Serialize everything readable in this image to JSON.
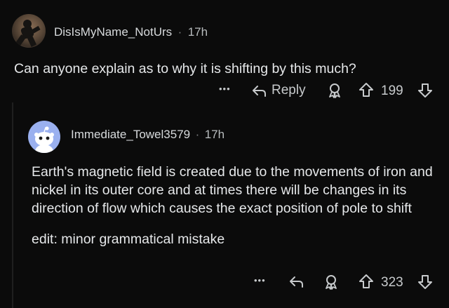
{
  "comment1": {
    "username": "DisIsMyName_NotUrs",
    "separator": "·",
    "time": "17h",
    "body": "Can anyone explain as to why it is shifting by this much?",
    "more": "•••",
    "reply_label": "Reply",
    "score": "199",
    "icons": {
      "more": "more-dots-icon",
      "reply": "reply-arrow-icon",
      "award": "award-icon",
      "upvote": "upvote-arrow-icon",
      "downvote": "downvote-arrow-icon"
    }
  },
  "comment2": {
    "username": "Immediate_Towel3579",
    "separator": "·",
    "time": "17h",
    "paragraphs": [
      "Earth's magnetic field is created due to the movements of iron and nickel in its outer core and at times there will be changes in its direction of flow which causes the exact position of pole to shift",
      "edit: minor grammatical mistake"
    ],
    "more": "•••",
    "score": "323",
    "icons": {
      "more": "more-dots-icon",
      "reply": "reply-arrow-icon",
      "award": "award-icon",
      "upvote": "upvote-arrow-icon",
      "downvote": "downvote-arrow-icon"
    }
  },
  "colors": {
    "background": "#0b0b0b",
    "text": "#d7dadc",
    "muted": "#818384",
    "avatar2_bg": "#9ab0ef"
  }
}
